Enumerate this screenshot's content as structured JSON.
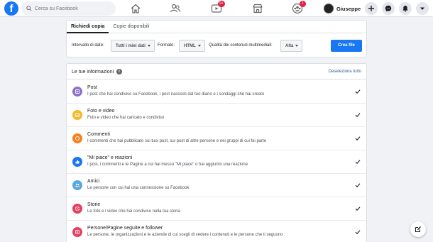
{
  "app": {
    "logo_letter": "f",
    "brand_color": "#1877f2"
  },
  "search": {
    "placeholder": "Cerca su Facebook",
    "icon": "search-icon"
  },
  "nav": {
    "items": [
      {
        "icon": "home-icon"
      },
      {
        "icon": "friends-icon"
      },
      {
        "icon": "watch-icon",
        "badge": "9+"
      },
      {
        "icon": "marketplace-icon"
      },
      {
        "icon": "groups-icon",
        "badge": "1"
      }
    ]
  },
  "profile": {
    "name": "Giuseppe"
  },
  "actions": [
    {
      "icon": "plus-icon"
    },
    {
      "icon": "messenger-icon"
    },
    {
      "icon": "bell-icon"
    },
    {
      "icon": "caret-down-icon"
    }
  ],
  "tabs": [
    {
      "label": "Richiedi copia",
      "active": true
    },
    {
      "label": "Copie disponibili",
      "active": false
    }
  ],
  "controls": {
    "date_label": "Intervallo di date:",
    "date_value": "Tutti i miei dati",
    "format_label": "Formato:",
    "format_value": "HTML",
    "quality_label": "Qualità dei contenuti multimediali:",
    "quality_value": "Alta",
    "create_button": "Crea file"
  },
  "info": {
    "title": "Le tue informazioni",
    "info_mark": "i",
    "deselect": "Deseleziona tutto",
    "rows": [
      {
        "title": "Post",
        "desc": "I post che hai condiviso su Facebook, i post nascosti dal tuo diario e i sondaggi che hai creato",
        "icon": "post-icon",
        "color": "#8c72cb"
      },
      {
        "title": "Foto e video",
        "desc": "Foto e video che hai caricato e condiviso",
        "icon": "photo-icon",
        "color": "#f7b928"
      },
      {
        "title": "Commenti",
        "desc": "I commenti che hai pubblicato sui tuoi post, sui post di altre persone e nei gruppi di cui fai parte",
        "icon": "comment-icon",
        "color": "#f5821f"
      },
      {
        "title": "\"Mi piace\" e reazioni",
        "desc": "I post, i commenti e le Pagine a cui hai messo \"Mi piace\" o hai aggiunto una reazione",
        "icon": "like-icon",
        "color": "#1877f2"
      },
      {
        "title": "Amici",
        "desc": "Le persone con cui hai una connessione su Facebook",
        "icon": "friends-icon",
        "color": "#5aa7de"
      },
      {
        "title": "Storie",
        "desc": "Le foto e i video che hai condiviso nella tua storia",
        "icon": "stories-icon",
        "color": "#e4405f"
      },
      {
        "title": "Persone/Pagine seguite e follower",
        "desc": "Le persone, le organizzazioni e le aziende di cui scegli di vedere i contenuti e le persone che ti seguono",
        "icon": "follow-icon",
        "color": "#e4405f"
      }
    ]
  },
  "fab": {
    "icon": "compose-icon"
  }
}
